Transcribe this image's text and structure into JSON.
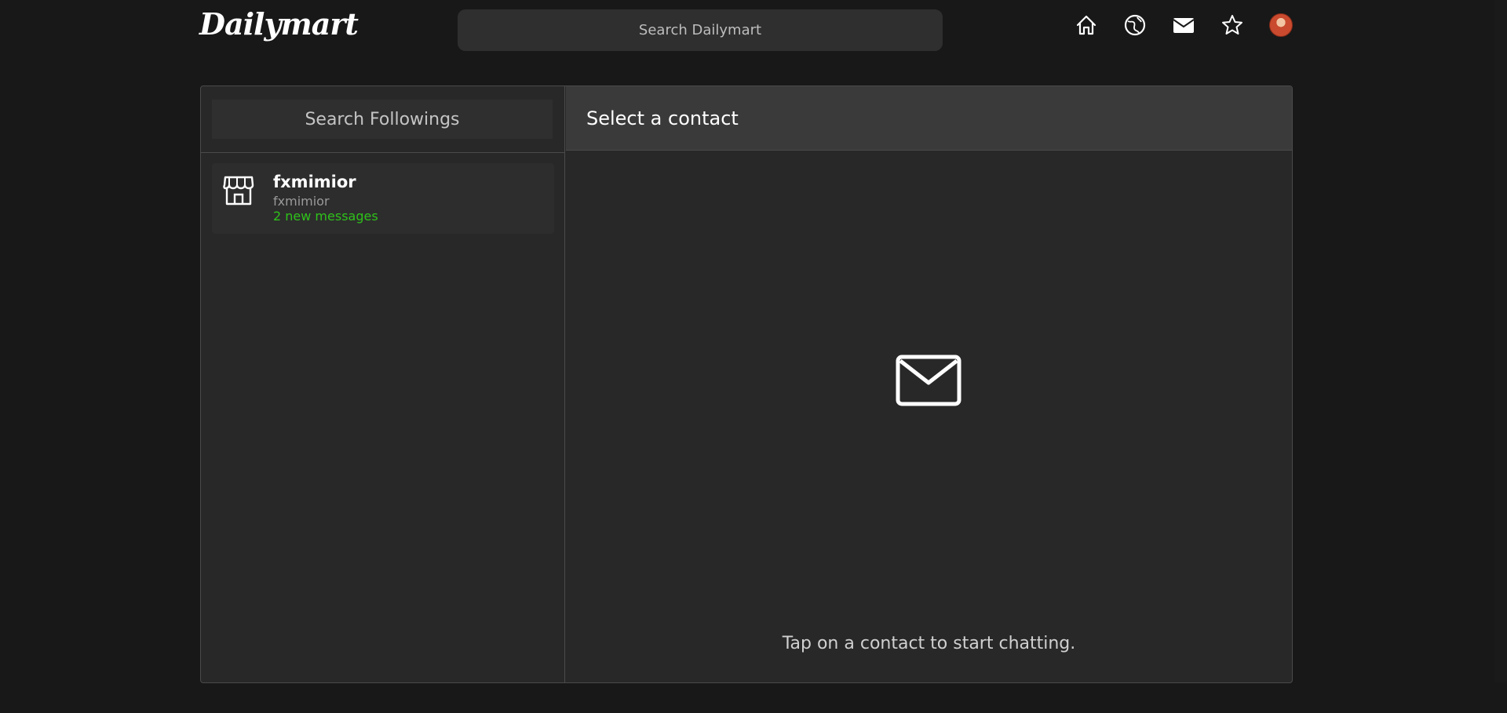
{
  "header": {
    "logo": "Dailymart",
    "search_placeholder": "Search Dailymart",
    "icons": [
      "home-icon",
      "explore-icon",
      "mail-icon",
      "star-icon",
      "avatar"
    ]
  },
  "sidebar": {
    "search_placeholder": "Search Followings",
    "contacts": [
      {
        "name": "fxmimior",
        "username": "fxmimior",
        "status": "2 new messages",
        "icon": "store-icon"
      }
    ]
  },
  "chat": {
    "title": "Select a contact",
    "empty_icon": "envelope-icon",
    "empty_text": "Tap on a contact to start chatting."
  },
  "colors": {
    "background": "#181818",
    "panel": "#282828",
    "accent_green": "#2ec21a"
  }
}
